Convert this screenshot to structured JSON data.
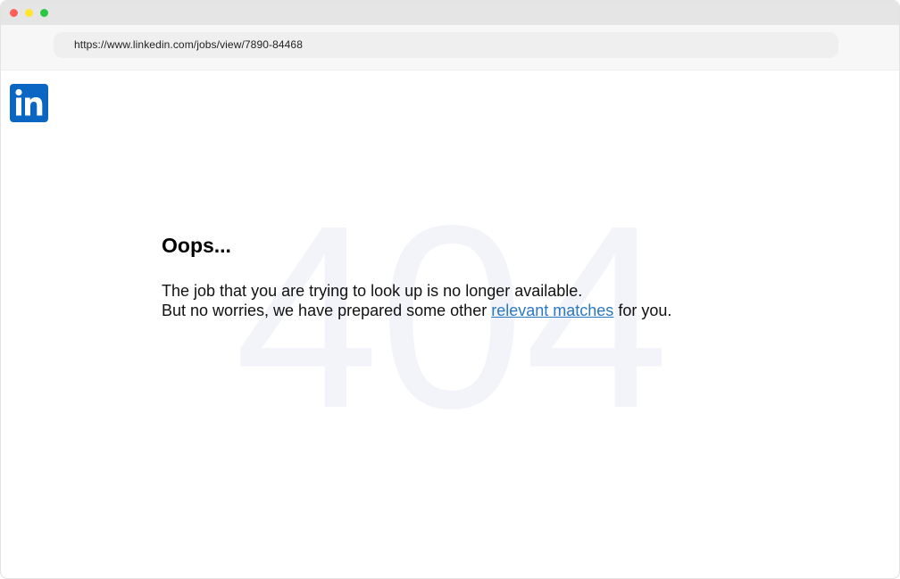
{
  "browser": {
    "url": "https://www.linkedin.com/jobs/view/7890-84468",
    "traffic_lights": {
      "close_color": "#ff5f57",
      "minimize_color": "#ffe52e",
      "maximize_color": "#28c840"
    }
  },
  "header": {
    "logo_icon": "linkedin-logo-icon",
    "logo_text": "in",
    "brand_color": "#0a66c2"
  },
  "error_page": {
    "background_code": "404",
    "title": "Oops...",
    "line1": "The job that you are trying to look up is no longer available.",
    "line2_before": "But no worries, we have prepared some other",
    "link_text": "relevant matches",
    "line2_after": "for you.",
    "link_color": "#2a78c3"
  }
}
